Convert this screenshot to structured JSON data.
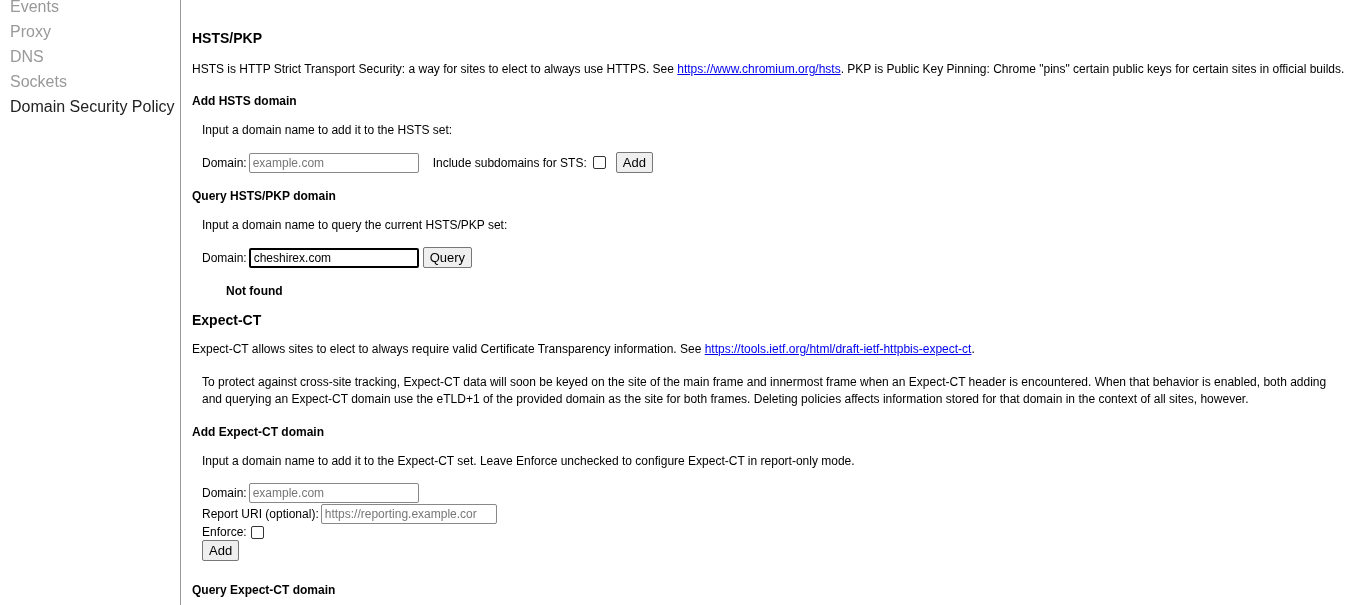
{
  "sidebar": {
    "items": [
      {
        "label": "Events",
        "selected": false
      },
      {
        "label": "Proxy",
        "selected": false
      },
      {
        "label": "DNS",
        "selected": false
      },
      {
        "label": "Sockets",
        "selected": false
      },
      {
        "label": "Domain Security Policy",
        "selected": true
      }
    ]
  },
  "hsts": {
    "title": "HSTS/PKP",
    "description": {
      "before": "HSTS is HTTP Strict Transport Security: a way for sites to elect to always use HTTPS. See ",
      "link": "https://www.chromium.org/hsts",
      "after": ". PKP is Public Key Pinning: Chrome \"pins\" certain public keys for certain sites in official builds."
    },
    "add": {
      "heading": "Add HSTS domain",
      "prompt": "Input a domain name to add it to the HSTS set:",
      "domain_label": "Domain:",
      "domain_placeholder": "example.com",
      "subdomains_label": "Include subdomains for STS:",
      "subdomains_checked": false,
      "button": "Add"
    },
    "query": {
      "heading": "Query HSTS/PKP domain",
      "prompt": "Input a domain name to query the current HSTS/PKP set:",
      "domain_label": "Domain:",
      "domain_value": "cheshirex.com",
      "button": "Query",
      "result": "Not found"
    }
  },
  "expect_ct": {
    "title": "Expect-CT",
    "description": {
      "before": "Expect-CT allows sites to elect to always require valid Certificate Transparency information. See ",
      "link": "https://tools.ietf.org/html/draft-ietf-httpbis-expect-ct",
      "after": "."
    },
    "note": "To protect against cross-site tracking, Expect-CT data will soon be keyed on the site of the main frame and innermost frame when an Expect-CT header is encountered. When that behavior is enabled, both adding and querying an Expect-CT domain use the eTLD+1 of the provided domain as the site for both frames. Deleting policies affects information stored for that domain in the context of all sites, however.",
    "add": {
      "heading": "Add Expect-CT domain",
      "prompt": "Input a domain name to add it to the Expect-CT set. Leave Enforce unchecked to configure Expect-CT in report-only mode.",
      "domain_label": "Domain:",
      "domain_placeholder": "example.com",
      "report_label": "Report URI (optional):",
      "report_placeholder": "https://reporting.example.cor",
      "enforce_label": "Enforce:",
      "enforce_checked": false,
      "button": "Add"
    },
    "query_heading": "Query Expect-CT domain"
  }
}
